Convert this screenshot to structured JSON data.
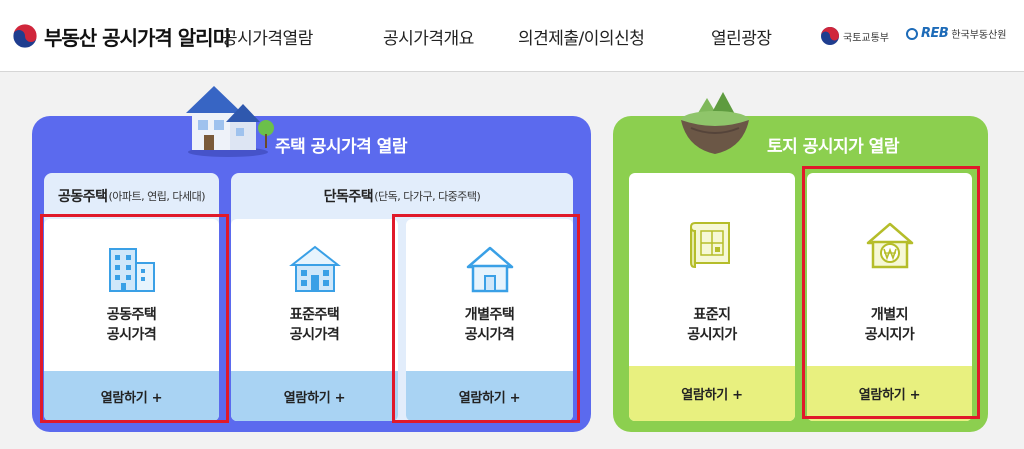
{
  "header": {
    "logo_text": "부동산 공시가격 알리미",
    "nav": [
      "공시가격열람",
      "공시가격개요",
      "의견제출/이의신청",
      "열린광장"
    ],
    "partners": {
      "molit": "국토교통부",
      "reb_mark": "REB",
      "reb": "한국부동산원"
    }
  },
  "house_panel": {
    "title": "주택 공시가격 열람",
    "apartment_group": {
      "title": "공동주택",
      "subtitle": "(아파트, 연립, 다세대)"
    },
    "detached_group": {
      "title": "단독주택",
      "subtitle": "(단독, 다가구, 다중주택)"
    },
    "cards": {
      "apartment": {
        "line1": "공동주택",
        "line2": "공시가격",
        "action": "열람하기 +"
      },
      "standard_house": {
        "line1": "표준주택",
        "line2": "공시가격",
        "action": "열람하기 +"
      },
      "individual_house": {
        "line1": "개별주택",
        "line2": "공시가격",
        "action": "열람하기 +"
      }
    }
  },
  "land_panel": {
    "title": "토지 공시지가 열람",
    "cards": {
      "standard_land": {
        "line1": "표준지",
        "line2": "공시지가",
        "action": "열람하기 +"
      },
      "individual_land": {
        "line1": "개별지",
        "line2": "공시지가",
        "action": "열람하기 +"
      }
    }
  },
  "colors": {
    "house_panel": "#5b6aee",
    "land_panel": "#8ccf4f",
    "house_foot": "#a9d3f3",
    "land_foot": "#e8f07f",
    "highlight": "#e0192a",
    "icon_blue": "#3aa0e6",
    "icon_olive": "#b5bd2a"
  }
}
